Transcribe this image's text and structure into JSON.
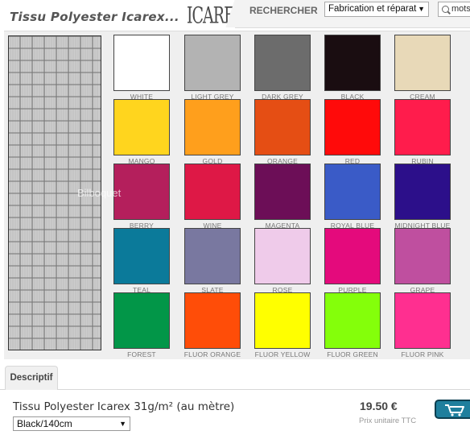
{
  "header": {
    "title": "Tissu Polyester Icarex...",
    "brand": "ICAREX",
    "search_label": "RECHERCHER",
    "category_select_value": "Fabrication et réparat",
    "search_value": "mots"
  },
  "colors": [
    {
      "name": "WHITE",
      "hex": "#ffffff"
    },
    {
      "name": "LIGHT GREY",
      "hex": "#b3b3b3"
    },
    {
      "name": "DARK GREY",
      "hex": "#6c6c6c"
    },
    {
      "name": "BLACK",
      "hex": "#1a0d11"
    },
    {
      "name": "CREAM",
      "hex": "#e8d9b8"
    },
    {
      "name": "MANGO",
      "hex": "#ffd51e"
    },
    {
      "name": "GOLD",
      "hex": "#ff9f1c"
    },
    {
      "name": "ORANGE",
      "hex": "#e54e14"
    },
    {
      "name": "RED",
      "hex": "#ff0a0a"
    },
    {
      "name": "RUBIN",
      "hex": "#ff1c4c"
    },
    {
      "name": "BERRY",
      "hex": "#b41f5c"
    },
    {
      "name": "WINE",
      "hex": "#de1846"
    },
    {
      "name": "MAGENTA",
      "hex": "#6c0e57"
    },
    {
      "name": "ROYAL BLUE",
      "hex": "#3a5bc7"
    },
    {
      "name": "MIDNIGHT BLUE",
      "hex": "#2c0f8a"
    },
    {
      "name": "TEAL",
      "hex": "#0b7a9a"
    },
    {
      "name": "SLATE",
      "hex": "#7978a0"
    },
    {
      "name": "ROSE",
      "hex": "#efcbea"
    },
    {
      "name": "PURPLE",
      "hex": "#e40a7c"
    },
    {
      "name": "GRAPE",
      "hex": "#bf4f9f"
    },
    {
      "name": "FOREST",
      "hex": "#029648"
    },
    {
      "name": "FLUOR ORANGE",
      "hex": "#ff4d08"
    },
    {
      "name": "FLUOR YELLOW",
      "hex": "#ffff00"
    },
    {
      "name": "FLUOR GREEN",
      "hex": "#84ff0a"
    },
    {
      "name": "FLUOR PINK",
      "hex": "#ff2f90"
    }
  ],
  "watermark": "Bilboquet",
  "tabs": [
    {
      "label": "Descriptif"
    }
  ],
  "product": {
    "name": "Tissu Polyester Icarex 31g/m² (au mètre)",
    "variant": "Black/140cm",
    "price": "19.50 €",
    "price_caption": "Prix unitaire TTC"
  },
  "icons": {
    "cart": "cart-icon",
    "search": "search-icon"
  }
}
